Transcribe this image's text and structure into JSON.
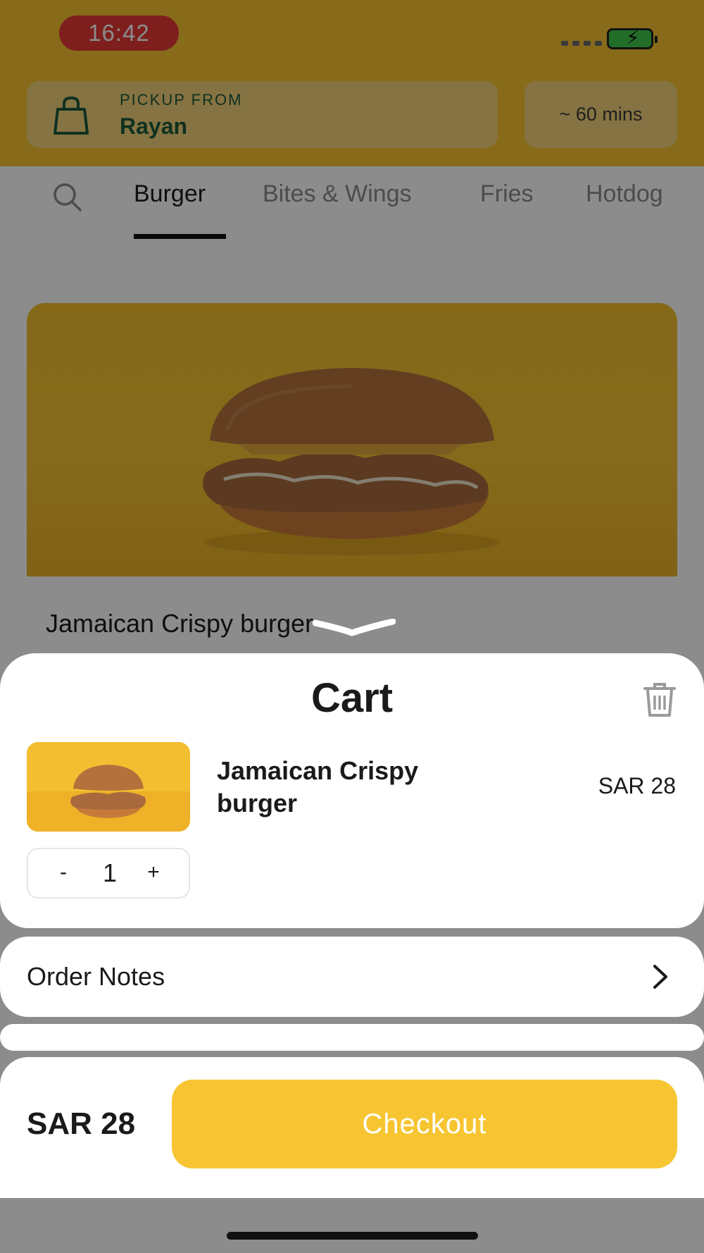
{
  "status_bar": {
    "time": "16:42"
  },
  "header": {
    "pickup_label": "PICKUP FROM",
    "pickup_location": "Rayan",
    "eta": "~ 60 mins"
  },
  "tabs": [
    {
      "label": "Burger",
      "active": true
    },
    {
      "label": "Bites & Wings",
      "active": false
    },
    {
      "label": "Fries",
      "active": false
    },
    {
      "label": "Hotdog",
      "active": false
    }
  ],
  "product": {
    "name": "Jamaican Crispy burger"
  },
  "cart": {
    "title": "Cart",
    "items": [
      {
        "name": "Jamaican Crispy burger",
        "price": "SAR 28",
        "quantity": "1",
        "minus_label": "-",
        "plus_label": "+"
      }
    ],
    "order_notes_label": "Order Notes",
    "total": "SAR 28",
    "checkout_label": "Checkout"
  },
  "colors": {
    "brand_yellow": "#f6c431",
    "checkout_button": "#f7c531",
    "pickup_text": "#1d5a3a",
    "status_time_bg": "#e53935"
  },
  "icons": {
    "search": "search-icon",
    "bag": "shopping-bag-icon",
    "trash": "trash-icon",
    "chevron": "chevron-right-icon",
    "battery": "battery-charging-icon"
  }
}
